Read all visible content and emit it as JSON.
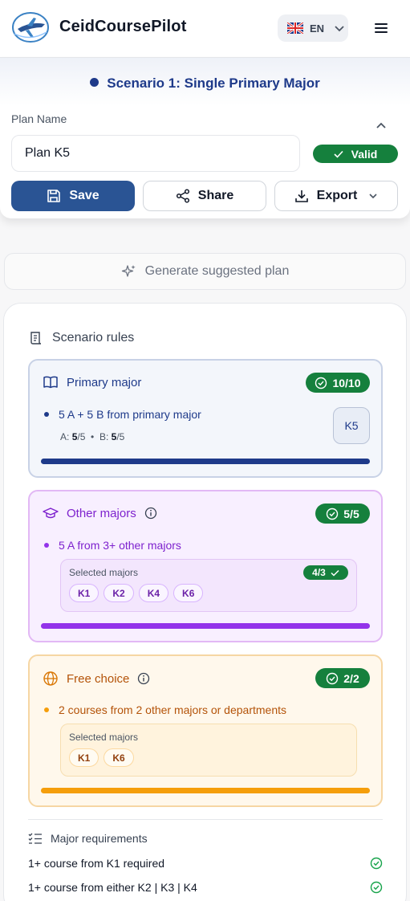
{
  "app": {
    "title": "CeidCoursePilot"
  },
  "language": {
    "code": "EN",
    "flag_icon": "uk-flag-icon"
  },
  "scenario": {
    "title": "Scenario 1: Single Primary Major",
    "color": "#1e3a8a"
  },
  "plan": {
    "name_label": "Plan Name",
    "name_value": "Plan K5",
    "status": "Valid",
    "save_label": "Save",
    "share_label": "Share",
    "export_label": "Export"
  },
  "generate": {
    "label": "Generate suggested plan"
  },
  "rules": {
    "title": "Scenario rules",
    "primary": {
      "title": "Primary major",
      "count": "10/10",
      "rule": "5 A + 5 B from primary major",
      "a_label": "A:",
      "a_value": "5",
      "a_total": "/5",
      "b_label": "B:",
      "b_value": "5",
      "b_total": "/5",
      "major": "K5",
      "progress": 1.0,
      "color": "#1e3a8a"
    },
    "other": {
      "title": "Other majors",
      "count": "5/5",
      "rule": "5 A from 3+ other majors",
      "selected_label": "Selected majors",
      "selected_count": "4/3",
      "chips": [
        "K1",
        "K2",
        "K4",
        "K6"
      ],
      "progress": 1.0,
      "color": "#9333ea"
    },
    "free": {
      "title": "Free choice",
      "count": "2/2",
      "rule": "2 courses from 2 other majors or departments",
      "selected_label": "Selected majors",
      "chips": [
        "K1",
        "K6"
      ],
      "progress": 1.0,
      "color": "#f59e0b"
    }
  },
  "requirements": {
    "title": "Major requirements",
    "items": [
      {
        "text": "1+ course from K1 required",
        "status": "ok"
      },
      {
        "text": "1+ course from either K2 | K3 | K4",
        "status": "ok"
      }
    ]
  }
}
